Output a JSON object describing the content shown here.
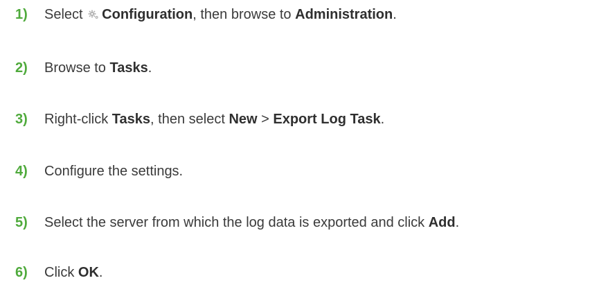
{
  "steps": [
    {
      "number": "1)",
      "parts": [
        "Select ",
        "Configuration",
        ", then browse to ",
        "Administration",
        "."
      ],
      "icon": "gear-icon"
    },
    {
      "number": "2)",
      "parts": [
        "Browse to ",
        "Tasks",
        "."
      ]
    },
    {
      "number": "3)",
      "parts": [
        "Right-click ",
        "Tasks",
        ", then select ",
        "New",
        " > ",
        "Export Log Task",
        "."
      ]
    },
    {
      "number": "4)",
      "parts": [
        "Configure the settings."
      ]
    },
    {
      "number": "5)",
      "parts": [
        "Select the server from which the log data is exported and click ",
        "Add",
        "."
      ]
    },
    {
      "number": "6)",
      "parts": [
        "Click ",
        "OK",
        "."
      ]
    }
  ],
  "colors": {
    "step_number": "#4faa3c",
    "text": "#3a3a3a",
    "icon": "#b3b3b3"
  }
}
